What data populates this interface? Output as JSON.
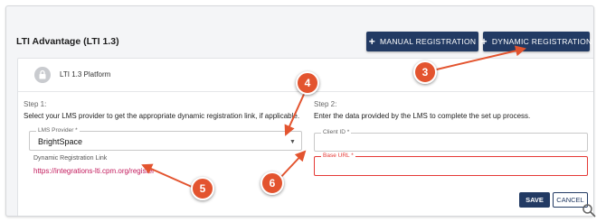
{
  "header": {
    "title": "LTI Advantage (LTI 1.3)",
    "manual_label": "MANUAL REGISTRATION",
    "dynamic_label": "DYNAMIC REGISTRATION"
  },
  "platform": {
    "label": "LTI 1.3 Platform"
  },
  "step1": {
    "label": "Step 1:",
    "description": "Select your LMS provider to get the appropriate dynamic registration link, if applicable.",
    "provider_label": "LMS Provider *",
    "provider_value": "BrightSpace",
    "link_label": "Dynamic Registration Link",
    "link_value": "https://integrations-lti.cpm.org/register"
  },
  "step2": {
    "label": "Step 2:",
    "description": "Enter the data provided by the LMS to complete the set up process.",
    "client_id_label": "Client ID *",
    "base_url_label": "Base URL *"
  },
  "actions": {
    "save_label": "SAVE",
    "cancel_label": "CANCEL"
  },
  "annotations": [
    "3",
    "4",
    "5",
    "6"
  ],
  "icons": {
    "lock": "lock-icon",
    "plus": "plus-icon",
    "dropdown": "chevron-down-icon",
    "zoom": "magnifier-icon"
  },
  "colors": {
    "primary": "#223a63",
    "link": "#c2185b",
    "error": "#e53935",
    "annotation": "#e3542f"
  }
}
